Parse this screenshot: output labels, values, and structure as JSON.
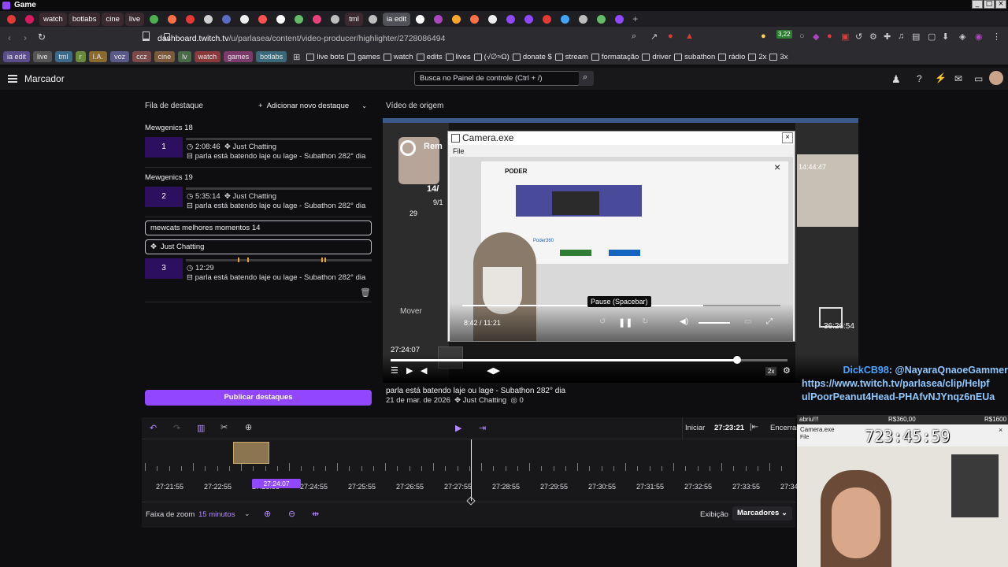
{
  "window": {
    "title": "Game"
  },
  "tabs": [
    {
      "label": "",
      "kind": "icon",
      "color": "#e53935"
    },
    {
      "label": "",
      "kind": "icon",
      "color": "#d81b60"
    },
    {
      "label": "watch",
      "kind": "text",
      "color": "#e05555"
    },
    {
      "label": "botlabs",
      "kind": "text",
      "color": "#5bbcd6"
    },
    {
      "label": "cine",
      "kind": "text",
      "color": "#e09050"
    },
    {
      "label": "live",
      "kind": "text",
      "color": "#cccccc"
    },
    {
      "label": "",
      "kind": "icon",
      "color": "#4caf50"
    },
    {
      "label": "",
      "kind": "icon",
      "color": "#ff7043"
    },
    {
      "label": "",
      "kind": "icon",
      "color": "#e53935"
    },
    {
      "label": "",
      "kind": "icon",
      "color": "#cfcfcf"
    },
    {
      "label": "",
      "kind": "icon",
      "color": "#5c6bc0"
    },
    {
      "label": "",
      "kind": "icon",
      "color": "#eeeeee"
    },
    {
      "label": "",
      "kind": "icon",
      "color": "#ff5252"
    },
    {
      "label": "",
      "kind": "icon",
      "color": "#ffffff"
    },
    {
      "label": "",
      "kind": "icon",
      "color": "#66bb6a"
    },
    {
      "label": "",
      "kind": "icon",
      "color": "#ec407a"
    },
    {
      "label": "",
      "kind": "icon",
      "color": "#bdbdbd"
    },
    {
      "label": "tml",
      "kind": "text",
      "color": "#5b9bd5"
    },
    {
      "label": "",
      "kind": "icon",
      "color": "#bdbdbd"
    },
    {
      "label": "ia edit",
      "kind": "text",
      "color": "#ffffff"
    },
    {
      "label": "",
      "kind": "icon",
      "color": "#ffffff"
    },
    {
      "label": "",
      "kind": "icon",
      "color": "#ab47bc"
    },
    {
      "label": "",
      "kind": "icon",
      "color": "#ffa726"
    },
    {
      "label": "",
      "kind": "icon",
      "color": "#ff7043"
    },
    {
      "label": "",
      "kind": "icon",
      "color": "#eeeeee"
    },
    {
      "label": "",
      "kind": "icon",
      "color": "#9147ff"
    },
    {
      "label": "",
      "kind": "icon",
      "color": "#9147ff"
    },
    {
      "label": "",
      "kind": "icon",
      "color": "#e53935"
    },
    {
      "label": "",
      "kind": "icon",
      "color": "#42a5f5"
    },
    {
      "label": "",
      "kind": "icon",
      "color": "#bdbdbd"
    },
    {
      "label": "",
      "kind": "icon",
      "color": "#66bb6a"
    },
    {
      "label": "",
      "kind": "icon",
      "color": "#9147ff"
    }
  ],
  "address": {
    "url_domain": "dashboard.twitch.tv",
    "url_path": "/u/parlasea/content/video-producer/highlighter/2728086494"
  },
  "bookmarks_chips": [
    {
      "label": "ia edit",
      "color": "#5a4d8a"
    },
    {
      "label": "live",
      "color": "#555"
    },
    {
      "label": "tml",
      "color": "#3e6a8a"
    },
    {
      "label": "r",
      "color": "#6a8a3e"
    },
    {
      "label": "I.A.",
      "color": "#8a6a2e"
    },
    {
      "label": "voz",
      "color": "#5a5a8a"
    },
    {
      "label": "ccz",
      "color": "#7a4a4a"
    },
    {
      "label": "cine",
      "color": "#7a5a3a"
    },
    {
      "label": "lv",
      "color": "#4a6a4a"
    },
    {
      "label": "watch",
      "color": "#8a3a3a"
    },
    {
      "label": "games",
      "color": "#7a3a6a"
    },
    {
      "label": "botlabs",
      "color": "#3a6a7a"
    }
  ],
  "bookmarks": [
    "live bots",
    "games",
    "watch",
    "edits",
    "lives",
    "(√∅≈Ω)",
    "donate $",
    "stream",
    "formatação",
    "driver",
    "subathon",
    "rádio",
    "2x",
    "3x"
  ],
  "header": {
    "page_title": "Marcador",
    "search_placeholder": "Busca no Painel de controle (Ctrl + /)"
  },
  "queue": {
    "title": "Fila de destaque",
    "add_label": "Adicionar novo destaque",
    "items": [
      {
        "group": "Mewgenics 18",
        "number": "1",
        "duration": "2:08:46",
        "category": "Just Chatting",
        "title": "parla está batendo laje ou lage - Subathon 282° dia"
      },
      {
        "group": "Mewgenics 19",
        "number": "2",
        "duration": "5:35:14",
        "category": "Just Chatting",
        "title": "parla está batendo laje ou lage - Subathon 282° dia"
      }
    ],
    "edit_item": {
      "title_value": "mewcats melhores momentos 14",
      "category_value": "Just Chatting",
      "number": "3",
      "duration": "12:29",
      "title": "parla está batendo laje ou lage - Subathon 282° dia"
    },
    "publish_label": "Publicar destaques"
  },
  "source": {
    "title": "Vídeo de origem",
    "video_time": "27:24:07",
    "cam_window_title": "Camera.exe",
    "cam_menu": "File",
    "cam_time": "8:42 / 11:21",
    "tooltip": "Pause (Spacebar)",
    "overlay_clock": "36:26:54",
    "overlay_small": "14:44:47",
    "vod_title": "parla está batendo laje ou lage - Subathon 282° dia",
    "vod_date": "21 de mar. de 2026",
    "vod_category": "Just Chatting",
    "vod_views": "0",
    "speed": "2x",
    "news_logo": "PODER",
    "news_source": "Poder360",
    "overlay_labels": [
      "Rem",
      "14/",
      "9/1",
      "29",
      "Mover"
    ]
  },
  "chat": {
    "line1_user": "DickCB98",
    "line1_mention": ": @NayaraQnaoeGammer",
    "line2": "https://www.twitch.tv/parlasea/clip/Helpf",
    "line3": "ulPoorPeanut4Head-PHAfvNJYnqz6nEUa"
  },
  "timeline": {
    "start_label": "Iniciar",
    "start_value": "27:23:21",
    "end_label": "Encerrar",
    "playhead_time": "27:24:07",
    "ticks": [
      "27:21:55",
      "27:22:55",
      "27:23:55",
      "27:24:55",
      "27:25:55",
      "27:26:55",
      "27:27:55",
      "27:28:55",
      "27:29:55",
      "27:30:55",
      "27:31:55",
      "27:32:55",
      "27:33:55",
      "27:34"
    ],
    "zoom_label": "Faixa de zoom",
    "zoom_value": "15 minutos",
    "display_label": "Exibição",
    "display_value": "Marcadores"
  },
  "webcam": {
    "top_left": "abriu!!!",
    "top_mid": "R$360,00",
    "top_right": "R$1600",
    "cam_title": "Camera.exe",
    "cam_menu": "File",
    "clock": "723:45:59"
  },
  "colors": {
    "accent": "#9147ff",
    "bg": "#0e0e10",
    "panel": "#18181b"
  }
}
